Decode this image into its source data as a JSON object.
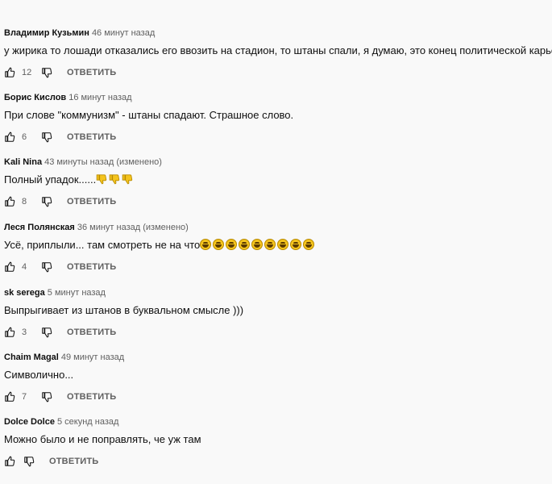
{
  "comments": [
    {
      "author": "Владимир Кузьмин",
      "time": "46 минут назад",
      "text": "у жирика то лошади отказались его ввозить на стадион, то штаны спали, я думаю, это конец политической карьере!",
      "likes": "12",
      "reply_label": "ОТВЕТИТЬ",
      "emojis": []
    },
    {
      "author": "Борис Кислов",
      "time": "16 минут назад",
      "text": "При слове \"коммунизм\" - штаны спадают. Страшное слово.",
      "likes": "6",
      "reply_label": "ОТВЕТИТЬ",
      "emojis": []
    },
    {
      "author": "Kali Nina",
      "time": "43 минуты назад (изменено)",
      "text": "Полный упадок......",
      "likes": "8",
      "reply_label": "ОТВЕТИТЬ",
      "emojis": [
        "thumbs-down",
        "thumbs-down",
        "thumbs-down"
      ]
    },
    {
      "author": "Леся Полянская",
      "time": "36 минут назад (изменено)",
      "text": "Усё, приплыли... там смотреть не на что",
      "likes": "4",
      "reply_label": "ОТВЕТИТЬ",
      "emojis": [
        "laughing-face",
        "laughing-face",
        "laughing-face",
        "laughing-face",
        "laughing-face",
        "laughing-face",
        "laughing-face",
        "laughing-face",
        "laughing-face"
      ]
    },
    {
      "author": "sk serega",
      "time": "5 минут назад",
      "text": "Выпрыгивает из штанов в буквальном смысле )))",
      "likes": "3",
      "reply_label": "ОТВЕТИТЬ",
      "emojis": []
    },
    {
      "author": "Chaim Magal",
      "time": "49 минут назад",
      "text": "Символично...",
      "likes": "7",
      "reply_label": "ОТВЕТИТЬ",
      "emojis": []
    },
    {
      "author": "Dolce Dolce",
      "time": "5 секунд назад",
      "text": "Можно было и не поправлять, че уж там",
      "likes": "",
      "reply_label": "ОТВЕТИТЬ",
      "emojis": []
    }
  ],
  "colors": {
    "text": "#0f0f0f",
    "secondary": "#606060",
    "background": "#f9f9f9",
    "emoji_yellow": "#f4c41e"
  }
}
